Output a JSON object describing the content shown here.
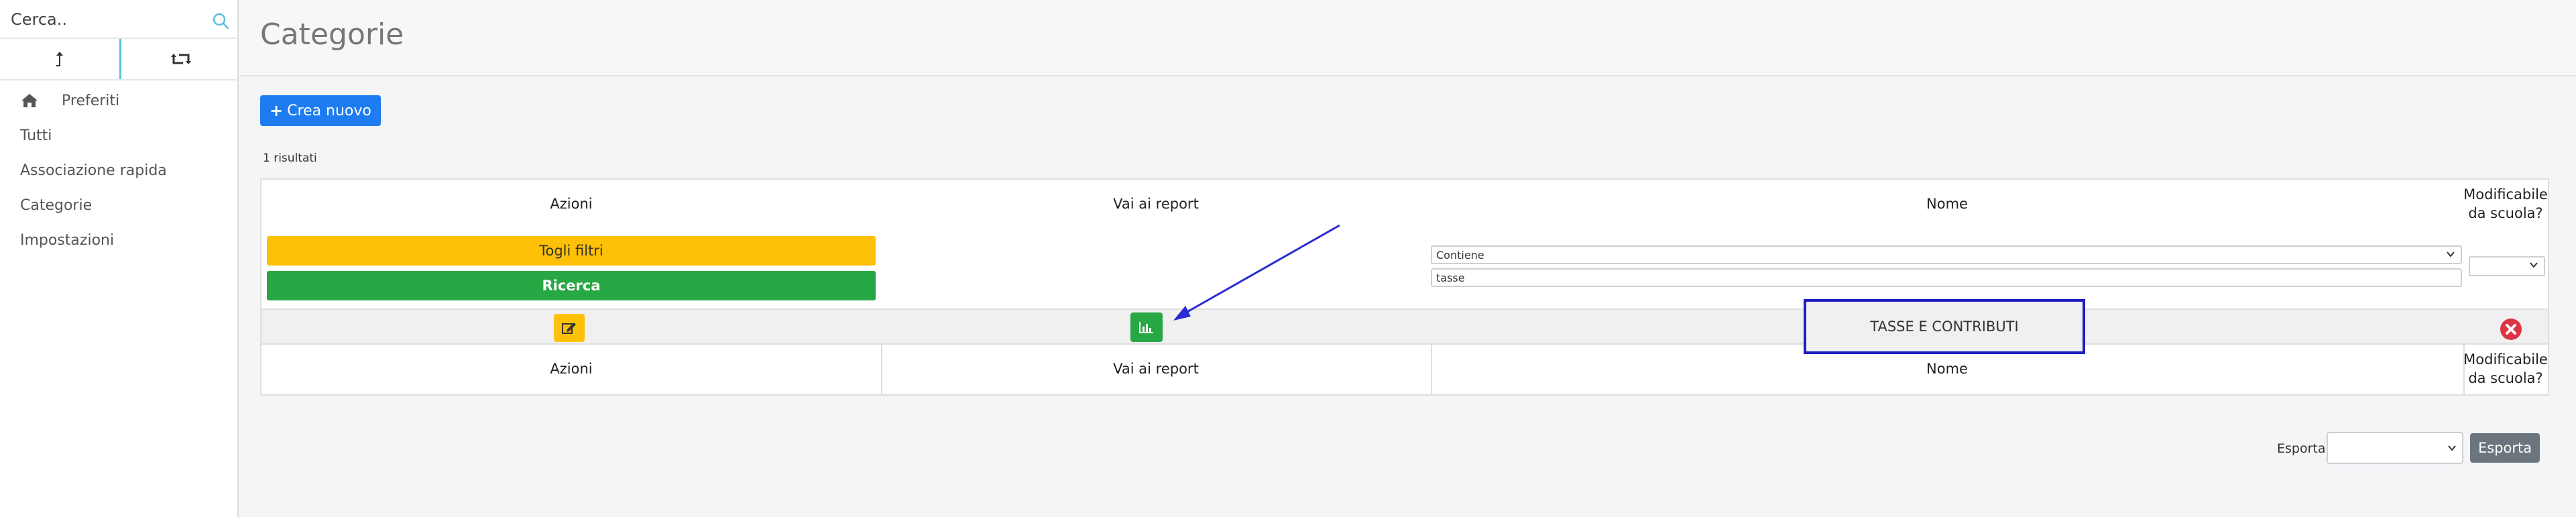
{
  "sidebar": {
    "search": {
      "placeholder": "Cerca.."
    },
    "menu": [
      {
        "label": "Preferiti"
      },
      {
        "label": "Tutti"
      },
      {
        "label": "Associazione rapida"
      },
      {
        "label": "Categorie"
      },
      {
        "label": "Impostazioni"
      }
    ]
  },
  "header": {
    "title": "Categorie"
  },
  "toolbar": {
    "create_label": "Crea nuovo"
  },
  "results": {
    "text": "1 risultati"
  },
  "table": {
    "columns": {
      "azioni": "Azioni",
      "report": "Vai ai report",
      "nome": "Nome",
      "modificabile_1": "Modificabile",
      "modificabile_2": "da scuola?"
    },
    "filters": {
      "clear_label": "Togli filtri",
      "search_label": "Ricerca",
      "match_mode": "Contiene",
      "name_value": "tasse"
    },
    "rows": [
      {
        "nome": "TASSE E CONTRIBUTI"
      }
    ]
  },
  "export": {
    "label": "Esporta",
    "button_label": "Esporta"
  },
  "colors": {
    "primary": "#1e7cf0",
    "warning": "#ffc107",
    "success": "#28a745",
    "danger": "#dc3545",
    "secondary": "#6c757d",
    "annotation": "#1f1fc0"
  }
}
